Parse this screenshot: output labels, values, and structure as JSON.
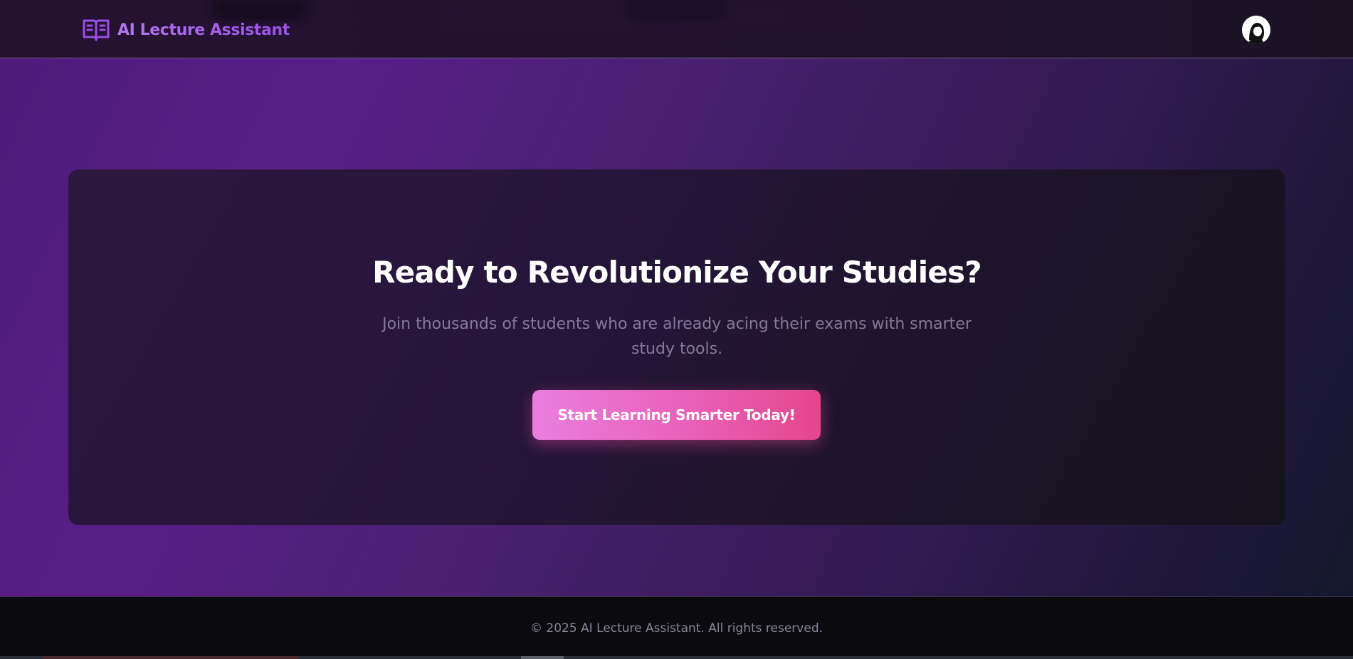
{
  "header": {
    "brand_name": "AI Lecture Assistant",
    "brand_icon": "open-book-icon",
    "avatar_icon": "user-avatar"
  },
  "hero": {
    "title": "Ready to Revolutionize Your Studies?",
    "subtitle": "Join thousands of students who are already acing their exams with smarter study tools.",
    "cta_label": "Start Learning Smarter Today!"
  },
  "footer": {
    "copyright": "© 2025 AI Lecture Assistant. All rights reserved."
  },
  "colors": {
    "brand_purple": "#9a4fe6",
    "hero_purple": "#581e88",
    "cta_pink_start": "#ea7ee0",
    "cta_pink_end": "#e5468c",
    "footer_bg": "#0b0a0f"
  }
}
